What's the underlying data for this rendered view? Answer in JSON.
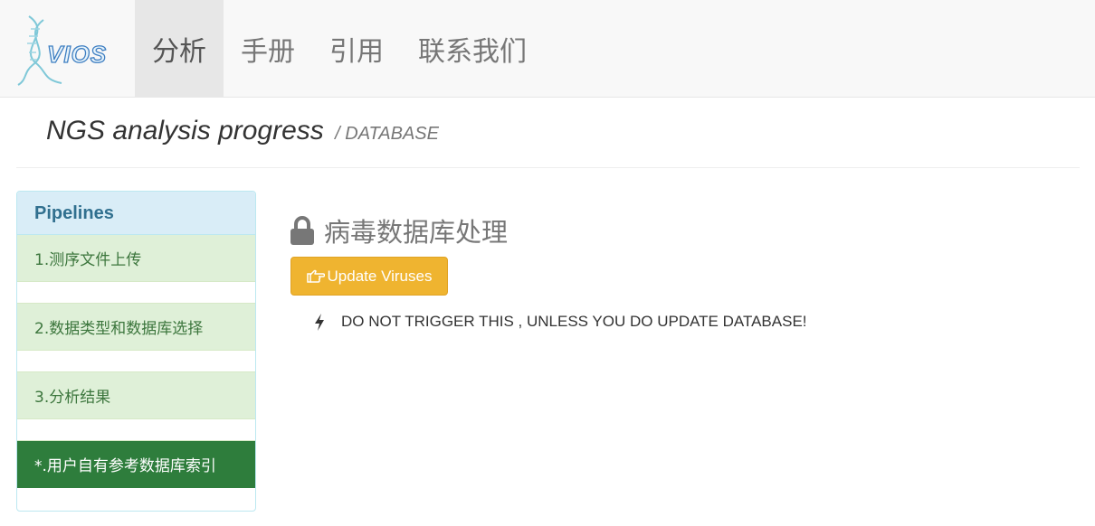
{
  "brand": {
    "logo_text": "VIOS"
  },
  "nav": {
    "items": [
      {
        "label": "分析"
      },
      {
        "label": "手册"
      },
      {
        "label": "引用"
      },
      {
        "label": "联系我们"
      }
    ]
  },
  "header": {
    "title": "NGS analysis progress",
    "subtitle": "/ DATABASE"
  },
  "sidebar": {
    "heading": "Pipelines",
    "steps": [
      {
        "label": "1.测序文件上传"
      },
      {
        "label": "2.数据类型和数据库选择"
      },
      {
        "label": "3.分析结果"
      },
      {
        "label": "*.用户自有参考数据库索引"
      }
    ]
  },
  "main": {
    "section_title": "病毒数据库处理",
    "update_button_label": "Update Viruses",
    "warning_text": "DO NOT TRIGGER THIS , UNLESS YOU DO UPDATE DATABASE!"
  },
  "icons": {
    "section": "lock-icon",
    "button": "hand-point-right-icon",
    "warning": "bolt-icon"
  },
  "colors": {
    "nav_bg": "#f8f8f8",
    "nav_active_bg": "#e7e7e7",
    "panel_heading_bg": "#d9edf7",
    "panel_heading_text": "#31708f",
    "step_bg": "#dff0d8",
    "step_text": "#3c763d",
    "step_active_bg": "#2e7d3c",
    "button_bg": "#efb430"
  }
}
